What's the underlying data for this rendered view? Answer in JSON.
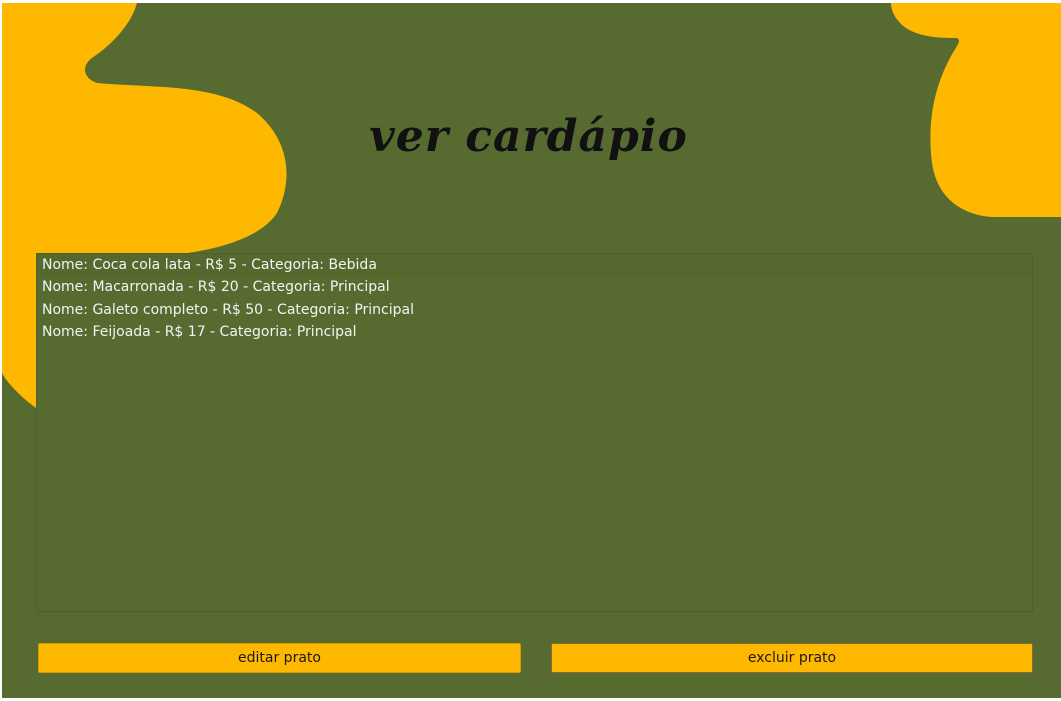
{
  "title": "ver cardápio",
  "menu_list": {
    "items": [
      "Nome: Coca cola lata - R$ 5 - Categoria: Bebida",
      "Nome: Macarronada - R$ 20 - Categoria: Principal",
      "Nome: Galeto completo - R$ 50 - Categoria: Principal",
      "Nome: Feijoada - R$ 17 - Categoria: Principal"
    ]
  },
  "buttons": {
    "edit": "editar prato",
    "delete": "excluir prato"
  },
  "colors": {
    "background": "#576b30",
    "accent": "#ffb800",
    "text_light": "#f3f3f3",
    "title": "#111111"
  }
}
